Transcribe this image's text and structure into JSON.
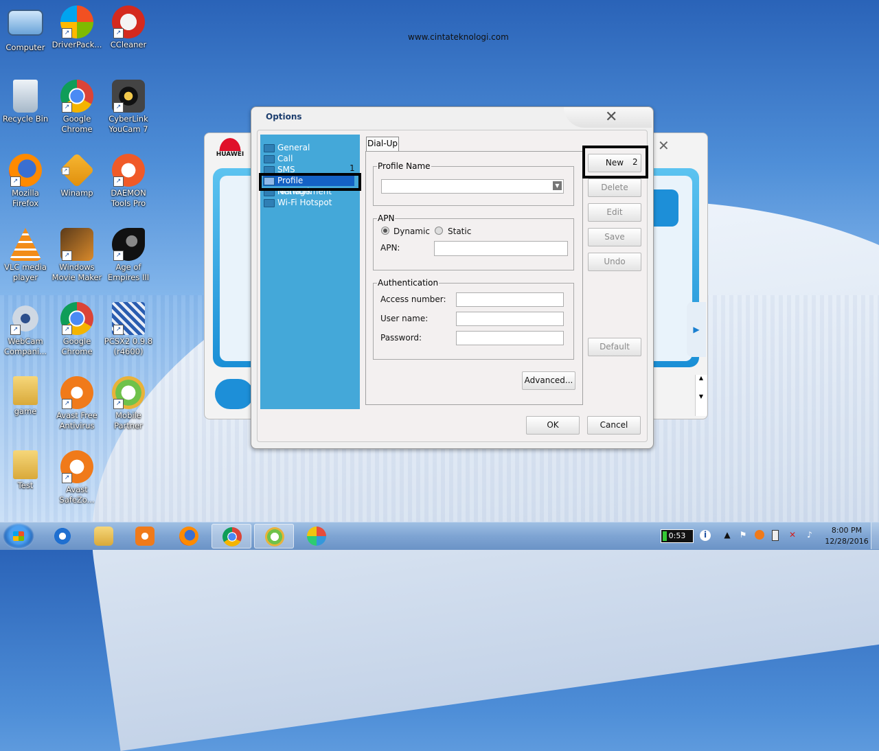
{
  "watermark": "www.cintateknologi.com",
  "desktop_icons": [
    {
      "label": "Computer"
    },
    {
      "label": "DriverPack..."
    },
    {
      "label": "CCleaner"
    },
    {
      "label": "Recycle Bin"
    },
    {
      "label": "Google Chrome"
    },
    {
      "label": "CyberLink YouCam 7"
    },
    {
      "label": "Mozilla Firefox"
    },
    {
      "label": "Winamp"
    },
    {
      "label": "DAEMON Tools Pro"
    },
    {
      "label": "VLC media player"
    },
    {
      "label": "Windows Movie Maker"
    },
    {
      "label": "Age of Empires III"
    },
    {
      "label": "WebCam Compani..."
    },
    {
      "label": "Google Chrome"
    },
    {
      "label": "PCSX2 0.9.8 (r4600)"
    },
    {
      "label": "game"
    },
    {
      "label": "Avast Free Antivirus"
    },
    {
      "label": "Mobile Partner"
    },
    {
      "label": "Test"
    },
    {
      "label": "Avast SafeZo..."
    }
  ],
  "huawei": {
    "logo_text": "HUAWEI"
  },
  "dialog": {
    "title": "Options",
    "nav": [
      {
        "label": "General"
      },
      {
        "label": "Call"
      },
      {
        "label": "SMS"
      },
      {
        "label": "Profile Management"
      },
      {
        "label": "Network"
      },
      {
        "label": "Wi-Fi Hotspot"
      }
    ],
    "selected_nav": "Profile Management",
    "marker_1": "1",
    "marker_2": "2",
    "tab": "Dial-Up",
    "profile_name": {
      "legend": "Profile Name",
      "value": ""
    },
    "apn": {
      "legend": "APN",
      "dynamic_label": "Dynamic",
      "static_label": "Static",
      "selected": "Dynamic",
      "apn_label": "APN:",
      "apn_value": ""
    },
    "auth": {
      "legend": "Authentication",
      "access_number_label": "Access number:",
      "user_name_label": "User name:",
      "password_label": "Password:"
    },
    "advanced_label": "Advanced...",
    "side_buttons": {
      "new": "New",
      "delete": "Delete",
      "edit": "Edit",
      "save": "Save",
      "undo": "Undo",
      "default": "Default"
    },
    "ok_label": "OK",
    "cancel_label": "Cancel"
  },
  "taskbar": {
    "apps": [
      "Internet Explorer",
      "Windows Explorer",
      "Media Player",
      "Firefox",
      "Google Chrome",
      "Mobile Partner",
      "Paint"
    ],
    "active_app": "Google Chrome",
    "battery_text": "0:53",
    "time": "8:00 PM",
    "date": "12/28/2016"
  },
  "colors": {
    "nav_bg": "#44a8d9",
    "nav_selected": "#1461c4",
    "dialog_title": "#1d3e6e"
  }
}
